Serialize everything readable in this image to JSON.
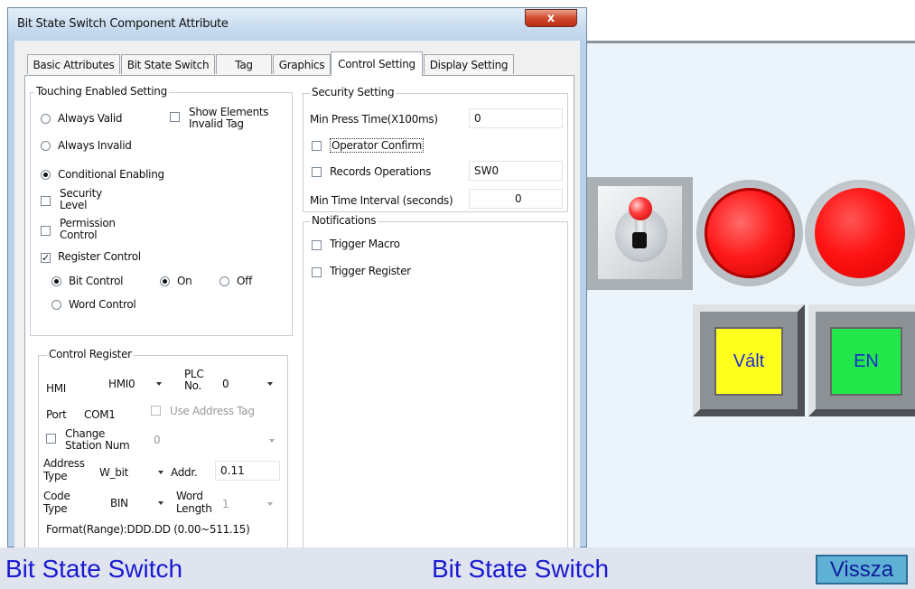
{
  "dialog": {
    "title": "Bit State Switch Component Attribute",
    "close_label": "x",
    "tabs": [
      "Basic Attributes",
      "Bit State Switch",
      "Tag",
      "Graphics",
      "Control Setting",
      "Display Setting"
    ],
    "active_tab": "Control Setting"
  },
  "touching": {
    "group_title": "Touching Enabled Setting",
    "always_valid": "Always Valid",
    "show_invalid_line1": "Show Elements",
    "show_invalid_line2": "Invalid Tag",
    "always_invalid": "Always Invalid",
    "conditional": "Conditional Enabling",
    "security_line1": "Security",
    "security_line2": "Level",
    "permission_line1": "Permission",
    "permission_line2": "Control",
    "register_control": "Register Control",
    "bit_control": "Bit Control",
    "on": "On",
    "off": "Off",
    "word_control": "Word Control"
  },
  "control_register": {
    "group_title": "Control Register",
    "hmi_label": "HMI",
    "hmi_value": "HMI0",
    "plc_label_line1": "PLC",
    "plc_label_line2": "No.",
    "plc_value": "0",
    "port_label": "Port",
    "port_value": "COM1",
    "use_address_tag": "Use Address Tag",
    "change_station_line1": "Change",
    "change_station_line2": "Station Num",
    "station_value": "0",
    "address_type_line1": "Address",
    "address_type_line2": "Type",
    "address_type_value": "W_bit",
    "addr_label": "Addr.",
    "addr_value": "0.11",
    "code_type_line1": "Code",
    "code_type_line2": "Type",
    "code_type_value": "BIN",
    "word_length_line1": "Word",
    "word_length_line2": "Length",
    "word_length_value": "1",
    "format": "Format(Range):DDD.DD (0.00~511.15)"
  },
  "security": {
    "group_title": "Security Setting",
    "min_press_label": "Min Press Time(X100ms)",
    "min_press_value": "0",
    "operator_confirm": "Operator Confirm",
    "records_operations": "Records Operations",
    "records_value": "SW0",
    "min_interval_label": "Min Time Interval (seconds)",
    "min_interval_value": "0"
  },
  "notifications": {
    "group_title": "Notifications",
    "trigger_macro": "Trigger Macro",
    "trigger_register": "Trigger Register"
  },
  "hmi_screen": {
    "valt_label": "Vált",
    "en_label": "EN",
    "footer_left": "Bit State Switch",
    "footer_center": "Bit State Switch",
    "back_button": "Vissza",
    "colors": {
      "lamp": "#ff1a1a",
      "valt": "#ffff1e",
      "en": "#22e64a",
      "text_blue": "#1a1ad0"
    }
  }
}
